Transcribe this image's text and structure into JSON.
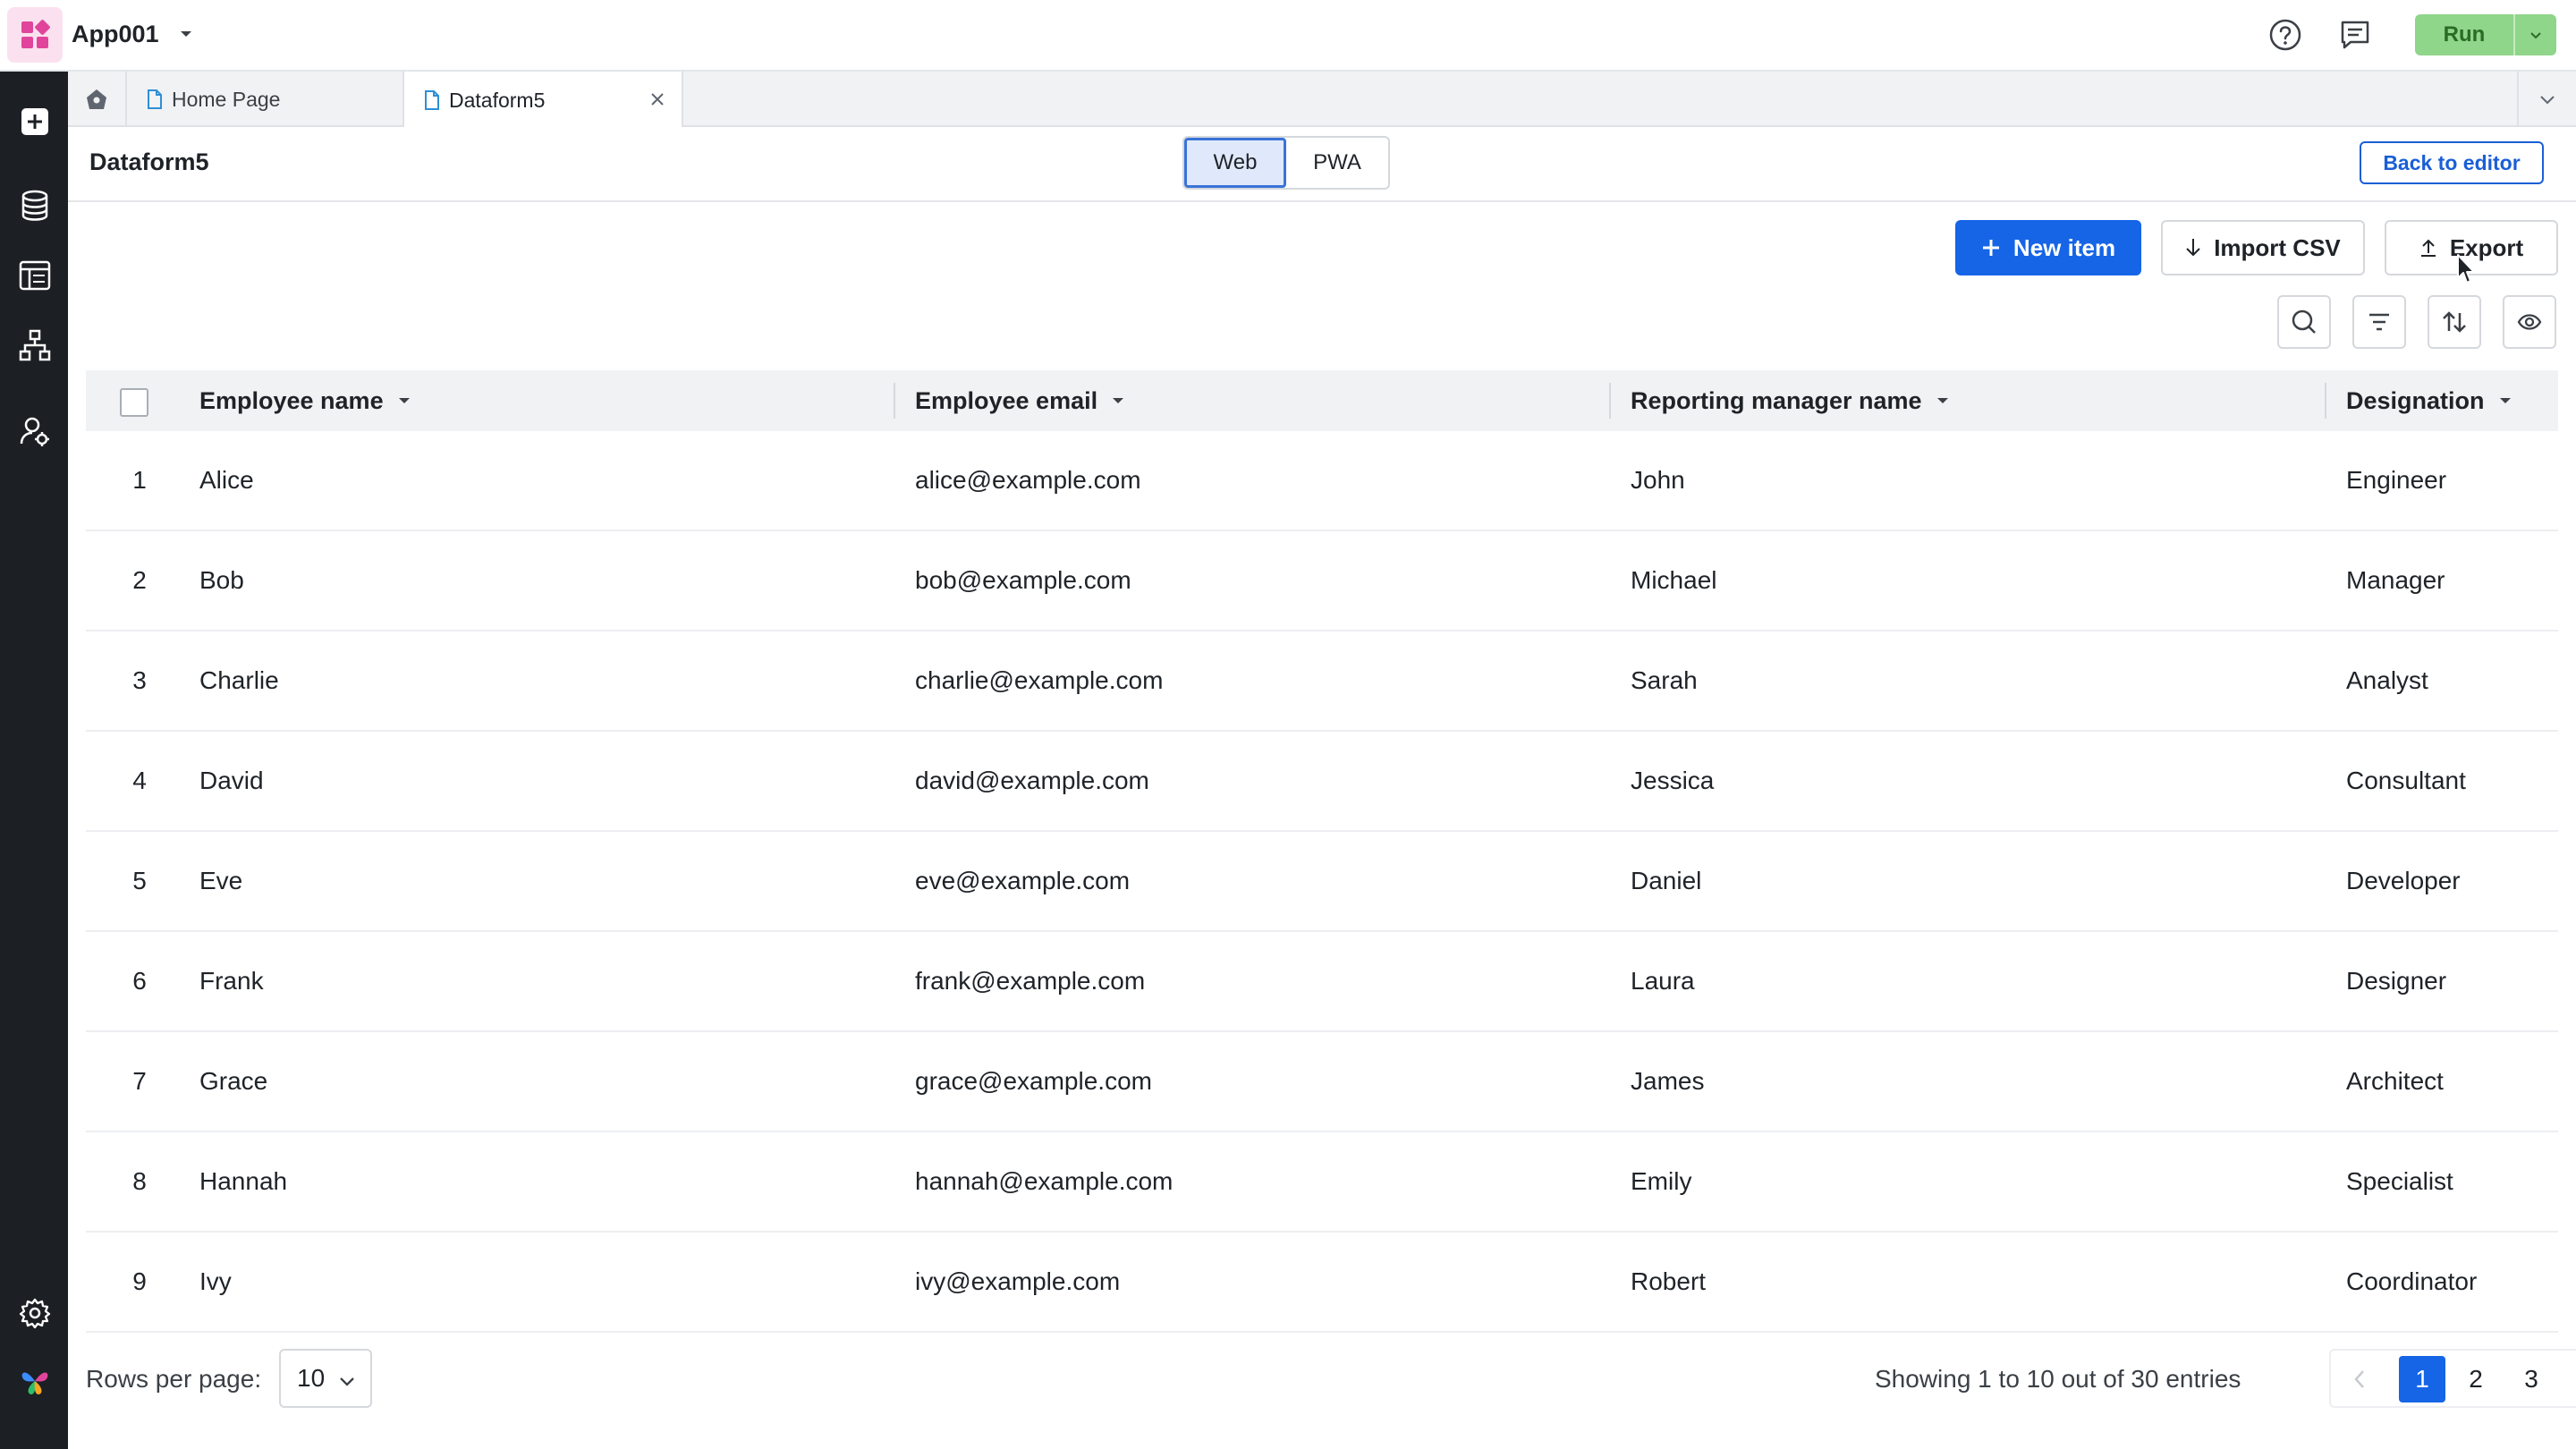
{
  "app": {
    "name": "App001"
  },
  "toolbar": {
    "run_label": "Run"
  },
  "tabs": [
    {
      "label": "Home Page"
    },
    {
      "label": "Dataform5"
    }
  ],
  "page": {
    "title": "Dataform5",
    "platform_options": [
      "Web",
      "PWA"
    ],
    "selected_platform": "Web",
    "back_label": "Back to editor"
  },
  "actions": {
    "new_item": "New item",
    "import_csv": "Import CSV",
    "export": "Export"
  },
  "table": {
    "columns": [
      "Employee name",
      "Employee email",
      "Reporting manager name",
      "Designation"
    ],
    "rows": [
      {
        "n": "1",
        "name": "Alice",
        "email": "alice@example.com",
        "manager": "John",
        "designation": "Engineer"
      },
      {
        "n": "2",
        "name": "Bob",
        "email": "bob@example.com",
        "manager": "Michael",
        "designation": "Manager"
      },
      {
        "n": "3",
        "name": "Charlie",
        "email": "charlie@example.com",
        "manager": "Sarah",
        "designation": "Analyst"
      },
      {
        "n": "4",
        "name": "David",
        "email": "david@example.com",
        "manager": "Jessica",
        "designation": "Consultant"
      },
      {
        "n": "5",
        "name": "Eve",
        "email": "eve@example.com",
        "manager": "Daniel",
        "designation": "Developer"
      },
      {
        "n": "6",
        "name": "Frank",
        "email": "frank@example.com",
        "manager": "Laura",
        "designation": "Designer"
      },
      {
        "n": "7",
        "name": "Grace",
        "email": "grace@example.com",
        "manager": "James",
        "designation": "Architect"
      },
      {
        "n": "8",
        "name": "Hannah",
        "email": "hannah@example.com",
        "manager": "Emily",
        "designation": "Specialist"
      },
      {
        "n": "9",
        "name": "Ivy",
        "email": "ivy@example.com",
        "manager": "Robert",
        "designation": "Coordinator"
      }
    ]
  },
  "footer": {
    "rows_per_page_label": "Rows per page:",
    "rows_per_page": "10",
    "entries_text": "Showing 1 to 10 out of 30 entries",
    "pages": [
      "1",
      "2",
      "3"
    ],
    "current_page": "1"
  },
  "colors": {
    "primary": "#1565e6",
    "run": "#8fd58a",
    "rail": "#1c1f24",
    "logo": "#e0459b"
  },
  "icons": [
    "app-logo-icon",
    "caret-down-icon",
    "help-icon",
    "comment-icon",
    "add-icon",
    "database-icon",
    "table-layout-icon",
    "flow-icon",
    "user-settings-icon",
    "settings-icon",
    "brand-icon",
    "home-icon",
    "document-icon",
    "close-icon",
    "chevron-down-icon",
    "plus-icon",
    "download-icon",
    "upload-icon",
    "search-icon",
    "filter-icon",
    "sort-icon",
    "eye-icon",
    "chevron-left-icon",
    "chevron-right-icon"
  ]
}
